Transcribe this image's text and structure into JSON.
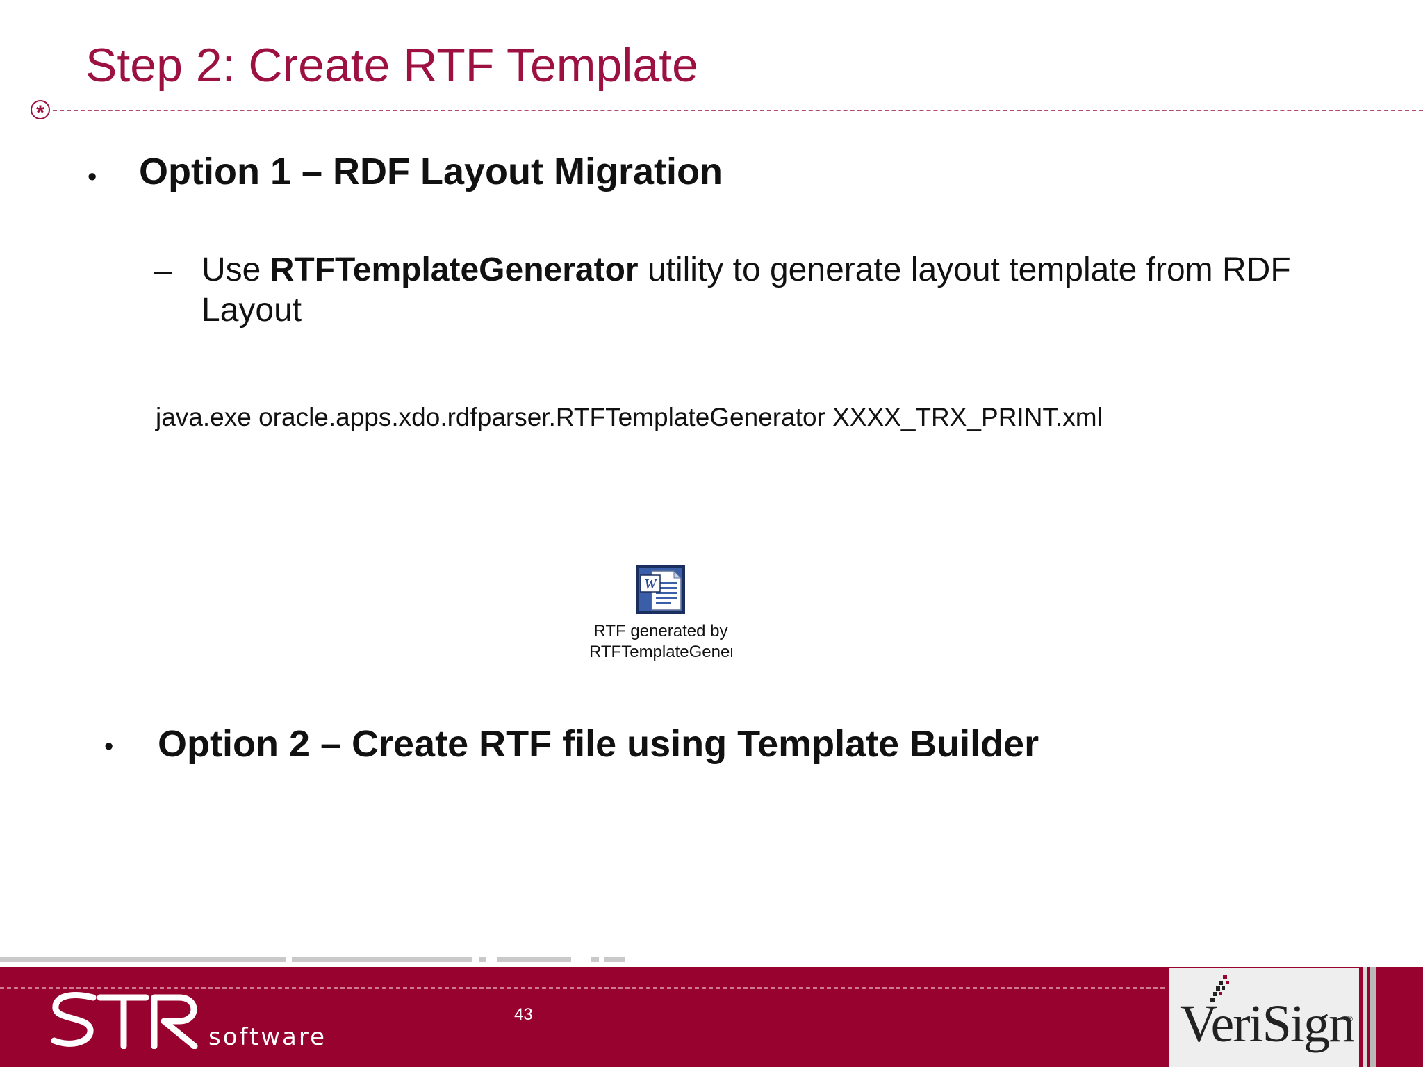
{
  "slide": {
    "title": "Step 2: Create RTF Template",
    "option1": {
      "bullet": "•",
      "label": "Option 1 – RDF Layout Migration",
      "sub": {
        "dash": "–",
        "prefix": "Use ",
        "tool": "RTFTemplateGenerator",
        "suffix": " utility to generate layout template from RDF Layout"
      },
      "command": "java.exe oracle.apps.xdo.rdfparser.RTFTemplateGenerator XXXX_TRX_PRINT.xml",
      "attachment": {
        "icon": "word-document-icon",
        "caption_line1": "RTF generated by",
        "caption_line2": "RTFTemplateGenerator"
      }
    },
    "option2": {
      "bullet": "•",
      "label": "Option 2 – Create RTF file using Template Builder"
    }
  },
  "footer": {
    "logo_word": "software",
    "page_number": "43",
    "partner_logo": "VeriSign",
    "registered_mark": "®"
  },
  "colors": {
    "title": "#9c1142",
    "footer_bg": "#98022e",
    "text": "#111111"
  }
}
